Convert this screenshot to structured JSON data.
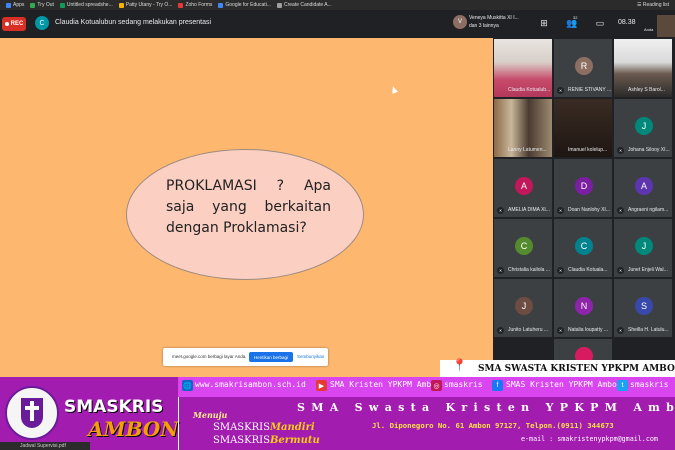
{
  "browser": {
    "bookmarks": [
      {
        "label": "Apps",
        "color": "#4285f4"
      },
      {
        "label": "Try Out",
        "color": "#34a853"
      },
      {
        "label": "Untitled spreadshe...",
        "color": "#0f9d58"
      },
      {
        "label": "Patty Utany - Try O...",
        "color": "#f4b400"
      },
      {
        "label": "Zoho Forms",
        "color": "#e53935"
      },
      {
        "label": "Google for Educati...",
        "color": "#4285f4"
      },
      {
        "label": "Create Candidate A...",
        "color": "#9e9e9e"
      }
    ],
    "reading_list": "Reading list"
  },
  "meet": {
    "rec_label": "REC",
    "presenter_initial": "C",
    "presenter_text": "Claudia Kotualubun sedang melakukan presentasi",
    "participants_text_1": "Veneya Muskitta XI I...",
    "participants_text_2": "dan 3 lainnya",
    "participants_count": "32",
    "clock": "08.38",
    "self_label": "Anda",
    "share_bar": {
      "text": "meet.google.com berbagi layar Anda.",
      "stop_button": "Hentikan berbagi",
      "hide_button": "Sembunyikan"
    },
    "tiles": [
      {
        "name": "Claudia Kotualub...",
        "initial": "",
        "color": "#3c4043",
        "video": true
      },
      {
        "name": "RENIE STIVANY ...",
        "initial": "R",
        "color": "#8d6e63"
      },
      {
        "name": "Ashley S Barol...",
        "initial": "",
        "color": "#3c4043",
        "video": true
      },
      {
        "name": "Lanny Latumen...",
        "initial": "",
        "color": "#3c4043",
        "video": true
      },
      {
        "name": "Imanuel kolelup...",
        "initial": "",
        "color": "#3c4043",
        "video": true
      },
      {
        "name": "Johana Silooy XI...",
        "initial": "J",
        "color": "#00897b"
      },
      {
        "name": "AMELIA DIMA XI...",
        "initial": "A",
        "color": "#c2185b"
      },
      {
        "name": "Doan Nanlohy XI...",
        "initial": "D",
        "color": "#7b1fa2"
      },
      {
        "name": "Angraeni ngilam...",
        "initial": "A",
        "color": "#5e35b1"
      },
      {
        "name": "Christalia kailola ...",
        "initial": "C",
        "color": "#558b2f"
      },
      {
        "name": "Claudia Kotuala...",
        "initial": "C",
        "color": "#00838f"
      },
      {
        "name": "Junet Enjeli Wal...",
        "initial": "J",
        "color": "#00897b"
      },
      {
        "name": "Junito Latuheru ...",
        "initial": "J",
        "color": "#6d4c41"
      },
      {
        "name": "Natalia loupatty ...",
        "initial": "N",
        "color": "#8e24aa"
      },
      {
        "name": "Sheilla H. Latulu...",
        "initial": "S",
        "color": "#3949ab"
      }
    ]
  },
  "slide": {
    "text": "PROKLAMASI ? Apa saja yang berkaitan dengan Proklamasi?"
  },
  "overlay": {
    "address_title": "SMA SWASTA KRISTEN YPKPM AMBON",
    "brand_line1": "SMASKRIS",
    "brand_line2": "AMBON",
    "website": "www.smakrisambon.sch.id",
    "youtube": "SMA Kristen YPKPM Ambon",
    "instagram": "smaskris",
    "facebook": "SMAS Kristen YPKPM Ambon",
    "twitter": "smaskris",
    "menuju": "Menuju",
    "motto_1_a": "SMASKRIS",
    "motto_1_b": "Mandiri",
    "motto_2_a": "SMASKRIS",
    "motto_2_b": "Bermutu",
    "school_name": "SMA Swasta Kristen YPKPM Ambon",
    "address": "Jl. Diponegoro  No. 61 Ambon 97127, Telpon.(0911) 344673",
    "email": "e-mail : smakristenypkpm@gmail.com"
  },
  "download": {
    "file": "Jadwal Supervisi.pdf"
  }
}
